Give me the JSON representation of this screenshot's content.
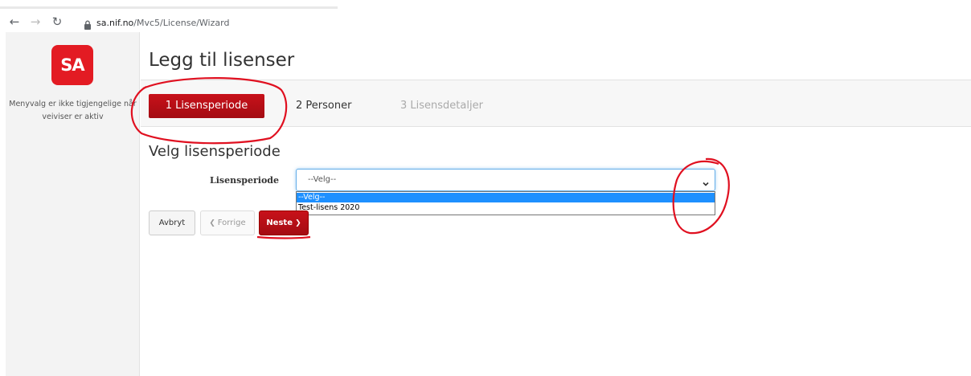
{
  "browser": {
    "url_host": "sa.nif.no",
    "url_path": "/Mvc5/License/Wizard"
  },
  "sidebar": {
    "logo_text": "SA",
    "note": "Menyvalg er ikke tigjengelige når veiviser er aktiv"
  },
  "page": {
    "title": "Legg til lisenser"
  },
  "steps": [
    {
      "label": "1 Lisensperiode",
      "state": "active"
    },
    {
      "label": "2 Personer",
      "state": "available"
    },
    {
      "label": "3 Lisensdetaljer",
      "state": "disabled"
    }
  ],
  "section": {
    "title": "Velg lisensperiode"
  },
  "form": {
    "label": "Lisensperiode",
    "selected_value": "--Velg--",
    "options": [
      "--Velg--",
      "Test-lisens 2020"
    ]
  },
  "buttons": {
    "cancel": "Avbryt",
    "previous": "Forrige",
    "next": "Neste"
  },
  "colors": {
    "brand_red": "#c8111a",
    "annotation_red": "#e01020",
    "option_highlight": "#1e90ff"
  }
}
